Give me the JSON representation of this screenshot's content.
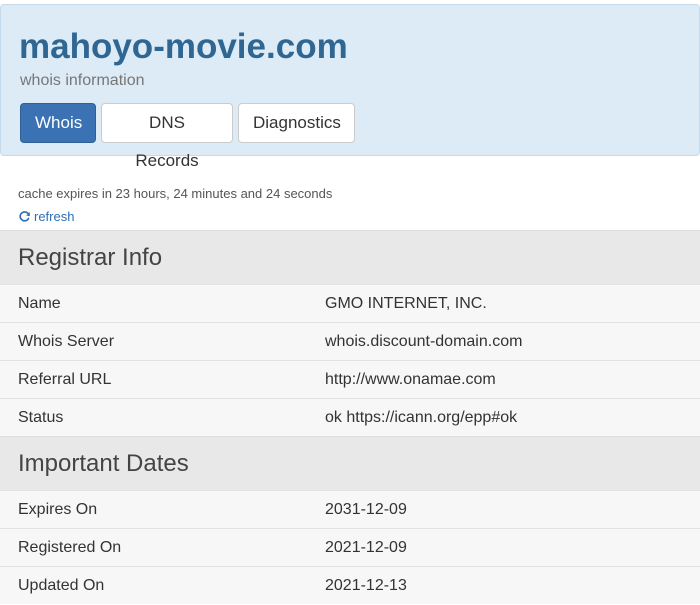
{
  "header": {
    "domain": "mahoyo-movie.com",
    "subtitle": "whois information",
    "tabs": [
      {
        "label": "Whois",
        "active": true
      },
      {
        "label": "DNS Records",
        "active": false
      },
      {
        "label": "Diagnostics",
        "active": false
      }
    ]
  },
  "cache": {
    "text": "cache expires in 23 hours, 24 minutes and 24 seconds",
    "refresh_label": "refresh",
    "refresh_icon": "refresh-icon"
  },
  "registrar": {
    "title": "Registrar Info",
    "rows": [
      {
        "label": "Name",
        "value": "GMO INTERNET, INC."
      },
      {
        "label": "Whois Server",
        "value": "whois.discount-domain.com"
      },
      {
        "label": "Referral URL",
        "value": "http://www.onamae.com"
      },
      {
        "label": "Status",
        "value": "ok https://icann.org/epp#ok"
      }
    ]
  },
  "dates": {
    "title": "Important Dates",
    "rows": [
      {
        "label": "Expires On",
        "value": "2031-12-09"
      },
      {
        "label": "Registered On",
        "value": "2021-12-09"
      },
      {
        "label": "Updated On",
        "value": "2021-12-13"
      }
    ]
  },
  "colors": {
    "header_bg": "#dcebf6",
    "title": "#2f6692",
    "active_tab": "#3a72b3",
    "link": "#2f6fb3",
    "section_bg": "#e8e8e8",
    "row_bg": "#f7f7f7"
  }
}
